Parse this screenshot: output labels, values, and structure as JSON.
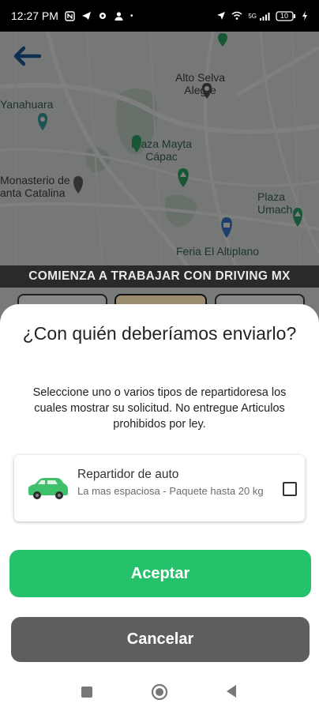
{
  "status_bar": {
    "time": "12:27 PM",
    "dot": "•",
    "battery": "10",
    "signal_label": "5G",
    "icons": [
      "nfc-icon",
      "telegram-icon",
      "gear-icon",
      "person-icon",
      "location-arrow-icon",
      "wifi-icon",
      "signal-icon",
      "battery-icon",
      "charging-icon"
    ]
  },
  "map": {
    "labels": {
      "alto_selva_alegre": "Alto Selva\nAlegre",
      "yanahuara": "Yanahuara",
      "plaza_mayta_capac": "Plaza Mayta\nCápac",
      "monasterio": "Monasterio de\nanta Catalina",
      "plaza_umach": "Plaza Umach",
      "feria": "Feria El Altiplano"
    },
    "colors": {
      "park": "#cfe3d3",
      "road": "#ffffff",
      "pin_green": "#2fae6a",
      "pin_teal": "#3aa6a6",
      "pin_blue": "#3d7fd6"
    }
  },
  "banner": {
    "text": "COMIENZA A TRABAJAR CON DRIVING MX"
  },
  "dialog": {
    "title": "¿Con quién deberíamos enviarlo?",
    "description": "Seleccione uno o varios tipos de repartidoresa los cuales mostrar su solicitud. No entregue Articulos prohibidos por ley.",
    "option": {
      "title": "Repartidor de auto",
      "subtitle": "La mas espaciosa - Paquete hasta 20 kg",
      "icon": "car-icon",
      "checked": false
    },
    "accept_label": "Aceptar",
    "cancel_label": "Cancelar"
  },
  "colors": {
    "accept": "#25c26b",
    "cancel": "#5e5e5e",
    "car": "#3fc06a"
  }
}
